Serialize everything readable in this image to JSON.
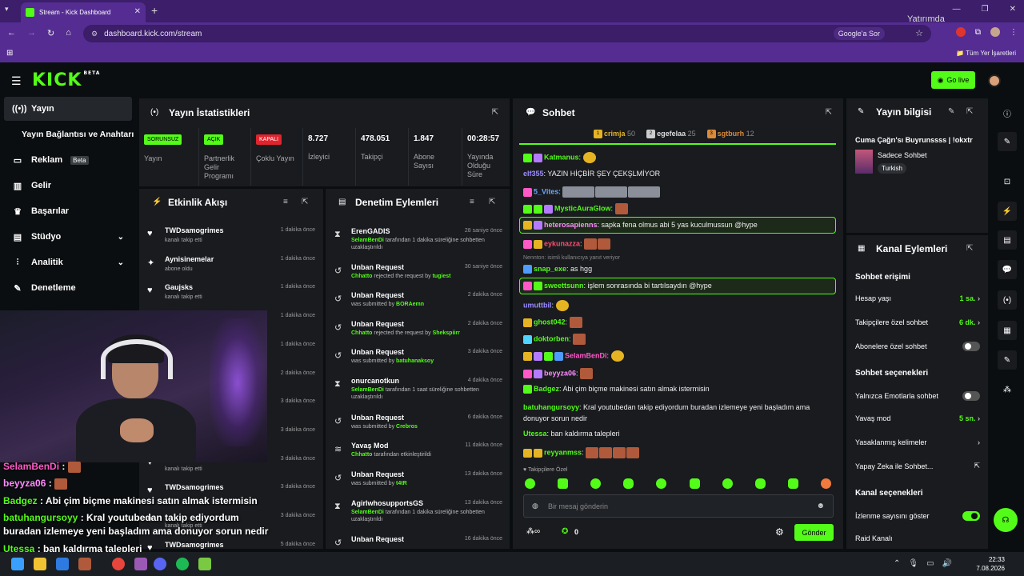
{
  "browser": {
    "tab_title": "Stream - Kick Dashboard",
    "url": "dashboard.kick.com/stream",
    "google_search": "Google'a Sor",
    "bookmarks_all": "Tüm Yer İşaretleri",
    "overlay_text": "Yatırımda"
  },
  "header": {
    "logo": "KICK",
    "logo_tag": "BETA",
    "go_live": "Go live"
  },
  "sidebar": {
    "items": [
      {
        "label": "Yayın"
      },
      {
        "label": "Yayın Bağlantısı ve Anahtarı"
      },
      {
        "label": "Reklam",
        "badge": "Beta"
      },
      {
        "label": "Gelir"
      },
      {
        "label": "Başarılar"
      },
      {
        "label": "Stüdyo"
      },
      {
        "label": "Analitik"
      },
      {
        "label": "Denetleme"
      }
    ]
  },
  "stats": {
    "title": "Yayın İstatistikleri",
    "cells": [
      {
        "badge": "SORUNSUZ",
        "label": "Yayın"
      },
      {
        "badge": "AÇIK",
        "label": "Partnerlik Gelir Programı"
      },
      {
        "badge": "KAPALI",
        "label": "Çoklu Yayın"
      },
      {
        "value": "8.727",
        "label": "İzleyici"
      },
      {
        "value": "478.051",
        "label": "Takipçi"
      },
      {
        "value": "1.847",
        "label": "Abone Sayısı"
      },
      {
        "value": "00:28:57",
        "label": "Yayında Olduğu Süre"
      }
    ]
  },
  "events": {
    "title": "Etkinlik Akışı",
    "items": [
      {
        "name": "TWDsamogrimes",
        "sub": "kanalı takip etti",
        "time": "1 dakika önce"
      },
      {
        "name": "Aynisinemelar",
        "sub": "abone oldu",
        "time": "1 dakika önce"
      },
      {
        "name": "Gaujsks",
        "sub": "kanalı takip etti",
        "time": "1 dakika önce"
      },
      {
        "name": "",
        "sub": "",
        "time": "1 dakika önce"
      },
      {
        "name": "",
        "sub": "",
        "time": "1 dakika önce"
      },
      {
        "name": "",
        "sub": "",
        "time": "2 dakika önce"
      },
      {
        "name": "",
        "sub": "",
        "time": "3 dakika önce"
      },
      {
        "name": "",
        "sub": "",
        "time": "3 dakika önce"
      },
      {
        "name": "",
        "sub": "kanalı takip etti",
        "time": "3 dakika önce"
      },
      {
        "name": "TWDsamogrimes",
        "sub": "",
        "time": "3 dakika önce"
      },
      {
        "name": "",
        "sub": "kanalı takip etti",
        "time": "3 dakika önce"
      },
      {
        "name": "TWDsamogrimes",
        "sub": "",
        "time": "5 dakika önce"
      }
    ]
  },
  "moderation": {
    "title": "Denetim Eylemleri",
    "items": [
      {
        "name": "ErenGADIS",
        "actor": "SelamBenDi",
        "desc": " tarafından 1 dakika süreliğine sohbetten uzaklaştırıldı",
        "time": "28 saniye önce"
      },
      {
        "name": "Unban Request",
        "actor": "Chhatto",
        "desc": " rejected the request by ",
        "actor2": "tugiest",
        "time": "30 saniye önce"
      },
      {
        "name": "Unban Request",
        "actor": "",
        "desc": "was submitted by ",
        "actor2": "BORAemn",
        "time": "2 dakika önce"
      },
      {
        "name": "Unban Request",
        "actor": "Chhatto",
        "desc": " rejected the request by ",
        "actor2": "Shekspiirr",
        "time": "2 dakika önce"
      },
      {
        "name": "Unban Request",
        "actor": "",
        "desc": "was submitted by ",
        "actor2": "batuhanaksoy",
        "time": "3 dakika önce"
      },
      {
        "name": "onurcanotkun",
        "actor": "SelamBenDi",
        "desc": " tarafından 1 saat süreliğine sohbetten uzaklaştırıldı",
        "time": "4 dakika önce"
      },
      {
        "name": "Unban Request",
        "actor": "",
        "desc": "was submitted by ",
        "actor2": "Crebros",
        "time": "6 dakika önce"
      },
      {
        "name": "Yavaş Mod",
        "actor": "Chhatto",
        "desc": " tarafından etkinleştirildi",
        "time": "11 dakika önce"
      },
      {
        "name": "Unban Request",
        "actor": "",
        "desc": "was submitted by ",
        "actor2": "t4tR",
        "time": "13 dakika önce"
      },
      {
        "name": "AgirlwhosupportsGS",
        "actor": "SelamBenDi",
        "desc": " tarafından 1 dakika süreliğine sohbetten uzaklaştırıldı",
        "time": "13 dakika önce"
      },
      {
        "name": "Unban Request",
        "actor": "",
        "desc": "",
        "time": "16 dakika önce"
      }
    ]
  },
  "chat": {
    "title": "Sohbet",
    "top_gifters": [
      {
        "rank": "1",
        "name": "crimja",
        "count": "50"
      },
      {
        "rank": "2",
        "name": "egefelaa",
        "count": "25"
      },
      {
        "rank": "3",
        "name": "sgtburh",
        "count": "12"
      }
    ],
    "messages": [
      {
        "user": "Katmanus",
        "color": "#53fc18",
        "text": ""
      },
      {
        "user": "elf355",
        "color": "#9a8cff",
        "text": "YAZIN HİÇBİR ŞEY ÇEKŞLMİYOR"
      },
      {
        "user": "5_Vites",
        "color": "#6aa7ff",
        "text": ""
      },
      {
        "user": "MysticAuraGlow",
        "color": "#53fc18",
        "text": ""
      },
      {
        "user": "heterosapienns",
        "color": "#ff8cff",
        "text": "sapka fena olmus abi 5 yas kuculmussun @hype"
      },
      {
        "user": "eykunazza",
        "color": "#ff4b6e",
        "text": ""
      },
      {
        "user": "snap_exe",
        "color": "#53fc18",
        "text": "as hgg",
        "reply": "Nennton: isimli kullanıcıya yanıt veriyor"
      },
      {
        "user": "sweettsunn",
        "color": "#53fc18",
        "text": "işlem sonrasında bi tartılsaydın @hype"
      },
      {
        "user": "umuttbil",
        "color": "#9a8cff",
        "text": ""
      },
      {
        "user": "ghost042",
        "color": "#53fc18",
        "text": ""
      },
      {
        "user": "doktorben",
        "color": "#53fc18",
        "text": ""
      },
      {
        "user": "SelamBenDi",
        "color": "#ff59c8",
        "text": ""
      },
      {
        "user": "beyyza06",
        "color": "#ff8cff",
        "text": ""
      },
      {
        "user": "Badgez",
        "color": "#53fc18",
        "text": "Abi çim biçme makinesi satın almak istermisin"
      },
      {
        "user": "batuhangursoyy",
        "color": "#53fc18",
        "text": "Kral youtubedan takip ediyordum buradan izlemeye yeni başladım ama donuyor sorun nedir"
      },
      {
        "user": "Utessa",
        "color": "#53fc18",
        "text": "ban kaldırma talepleri"
      },
      {
        "user": "reyyanmss",
        "color": "#53fc18",
        "text": ""
      }
    ],
    "followers_only": "Takipçilere Özel",
    "input_placeholder": "Bir mesaj gönderin",
    "points": "0",
    "send": "Gönder"
  },
  "stream_info": {
    "title": "Yayın bilgisi",
    "stream_title": "Cuma Çağrı'sı Buyrunssss | !okxtr",
    "category": "Sadece Sohbet",
    "tag": "Turkish"
  },
  "channel_actions": {
    "title": "Kanal Eylemleri",
    "sec1": "Sohbet erişimi",
    "account_age": {
      "label": "Hesap yaşı",
      "value": "1 sa."
    },
    "followers_chat": {
      "label": "Takipçilere özel sohbet",
      "value": "6 dk."
    },
    "subs_chat": {
      "label": "Abonelere özel sohbet"
    },
    "sec2": "Sohbet seçenekleri",
    "emote_only": {
      "label": "Yalnızca Emotlarla sohbet"
    },
    "slow_mode": {
      "label": "Yavaş mod",
      "value": "5 sn."
    },
    "banned_words": {
      "label": "Yasaklanmış kelimeler"
    },
    "ai_chat": {
      "label": "Yapay Zeka ile Sohbet..."
    },
    "sec3": "Kanal seçenekleri",
    "show_viewers": {
      "label": "İzlenme sayısını göster"
    },
    "raid": {
      "label": "Raid Kanalı"
    }
  },
  "overlay": {
    "lines": [
      {
        "user": "SelamBenDi",
        "text": ""
      },
      {
        "user": "beyyza06",
        "text": ""
      },
      {
        "user": "Badgez",
        "text": "Abi çim biçme makinesi satın almak istermisin"
      },
      {
        "user": "batuhangursoyy",
        "text": "Kral youtubedan takip ediyordum"
      },
      {
        "user": "",
        "text": "buradan izlemeye yeni başladım ama donuyor sorun nedir"
      },
      {
        "user": "Utessa",
        "text": "ban kaldırma talepleri"
      },
      {
        "user": "reyyanmss",
        "text": ""
      }
    ]
  },
  "taskbar": {
    "time": "22:33",
    "date": "7.08.2026"
  }
}
